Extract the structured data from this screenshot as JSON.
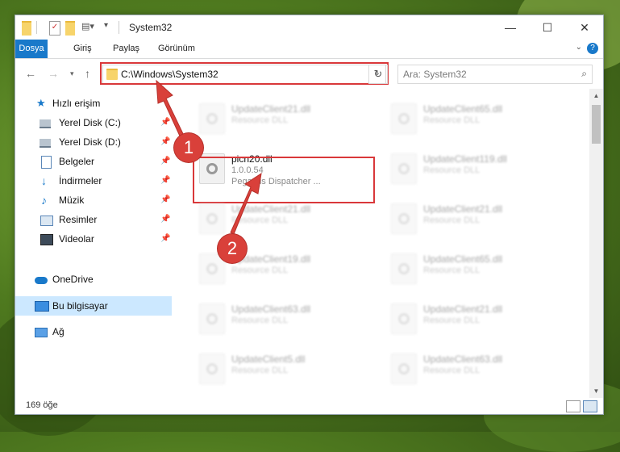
{
  "window": {
    "title": "System32"
  },
  "controls": {
    "minimize": "—",
    "maximize": "☐",
    "close": "✕"
  },
  "ribbon": {
    "tabs": [
      "Dosya",
      "Giriş",
      "Paylaş",
      "Görünüm"
    ],
    "help": "?"
  },
  "address": {
    "path": "C:\\Windows\\System32",
    "refresh": "↻"
  },
  "search": {
    "placeholder": "Ara: System32"
  },
  "sidebar": {
    "items": [
      {
        "label": "Hızlı erişim",
        "icon": "star-icon"
      },
      {
        "label": "Yerel Disk (C:)",
        "icon": "drive-icon",
        "pinned": true
      },
      {
        "label": "Yerel Disk (D:)",
        "icon": "drive-icon",
        "pinned": true
      },
      {
        "label": "Belgeler",
        "icon": "documents-icon",
        "pinned": true
      },
      {
        "label": "İndirmeler",
        "icon": "download-icon",
        "pinned": true
      },
      {
        "label": "Müzik",
        "icon": "music-icon",
        "pinned": true
      },
      {
        "label": "Resimler",
        "icon": "pictures-icon",
        "pinned": true
      },
      {
        "label": "Videolar",
        "icon": "video-icon",
        "pinned": true
      },
      {
        "label": "OneDrive",
        "icon": "cloud-icon"
      },
      {
        "label": "Bu bilgisayar",
        "icon": "computer-icon",
        "selected": true
      },
      {
        "label": "Ağ",
        "icon": "network-icon"
      }
    ]
  },
  "files": {
    "selected": {
      "name": "picn20.dll",
      "version": "1.0.0.54",
      "description": "Pegasus Dispatcher ..."
    },
    "left": [
      {
        "name": "UpdateClient21.dll",
        "type": "Resource DLL"
      },
      {
        "name": "UpdateClient21.dll",
        "type": "Resource DLL"
      },
      {
        "name": "UpdateClient19.dll",
        "type": "Resource DLL"
      },
      {
        "name": "UpdateClient63.dll",
        "type": "Resource DLL"
      },
      {
        "name": "UpdateClient5.dll",
        "type": "Resource DLL"
      }
    ],
    "right": [
      {
        "name": "UpdateClient65.dll",
        "type": "Resource DLL"
      },
      {
        "name": "UpdateClient119.dll",
        "type": "Resource DLL"
      },
      {
        "name": "UpdateClient21.dll",
        "type": "Resource DLL"
      },
      {
        "name": "UpdateClient65.dll",
        "type": "Resource DLL"
      },
      {
        "name": "UpdateClient21.dll",
        "type": "Resource DLL"
      },
      {
        "name": "UpdateClient63.dll",
        "type": "Resource DLL"
      }
    ]
  },
  "status": {
    "count": "169 öğe"
  },
  "annotations": [
    "1",
    "2"
  ],
  "colors": {
    "accent": "#1979ca",
    "highlight": "#d9383a",
    "selection": "#cce8ff"
  }
}
